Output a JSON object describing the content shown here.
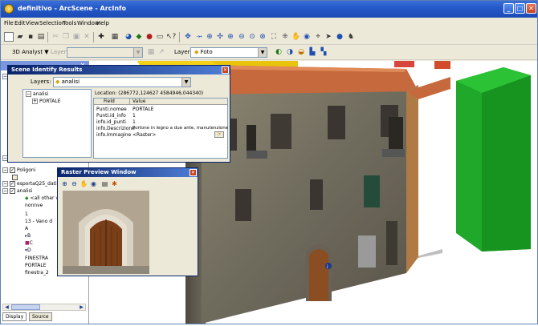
{
  "window": {
    "title": "definitivo - ArcScene - ArcInfo"
  },
  "menu": [
    "File",
    "Edit",
    "View",
    "Selection",
    "Tools",
    "Window",
    "Help"
  ],
  "toolbar2": {
    "analyst_label": "3D Analyst ▼",
    "layer_label": "Layer:",
    "layer_value": "Foto",
    "layer2_label": "Layer:"
  },
  "toc": {
    "rows": [
      {
        "check": "☑",
        "pm": "",
        "text": ""
      },
      {
        "check": "☑",
        "pm": "",
        "text": "Poligoni"
      },
      {
        "check": "☑",
        "pm": "",
        "text": "esportaQ25_dati"
      },
      {
        "check": "☑",
        "pm": "",
        "text": "analisi"
      },
      {
        "check": "",
        "pm": "",
        "text": "<all other values>"
      },
      {
        "check": "",
        "pm": "",
        "text": "nonnve"
      },
      {
        "check": "",
        "pm": "",
        "text": "1"
      },
      {
        "check": "",
        "pm": "",
        "text": "13 - Vano d"
      },
      {
        "check": "",
        "pm": "",
        "text": "A"
      },
      {
        "check": "",
        "pm": "",
        "text": "B"
      },
      {
        "check": "",
        "pm": "",
        "text": "C"
      },
      {
        "check": "",
        "pm": "",
        "text": "D"
      },
      {
        "check": "",
        "pm": "",
        "text": "FINESTRA"
      },
      {
        "check": "",
        "pm": "",
        "text": "PORTALE"
      },
      {
        "check": "",
        "pm": "",
        "text": "finestra_2"
      }
    ],
    "tabs": [
      "Display",
      "Source"
    ]
  },
  "identify": {
    "title": "Scene Identify Results",
    "layers_label": "Layers:",
    "layers_value": "analisi",
    "tree": [
      "analisi",
      "PORTALE"
    ],
    "location": "Location: (286772,124627 4584946,044340)",
    "columns": [
      "Field",
      "Value"
    ],
    "rows": [
      [
        "Punti.nomee",
        "PORTALE"
      ],
      [
        "Punti.id_info",
        "1"
      ],
      [
        "info.id_punti",
        "1"
      ],
      [
        "info.Descrizione",
        "Portone in legno a due ante, manutenzione"
      ],
      [
        "info.Immagine",
        "<Raster>"
      ]
    ]
  },
  "raster_preview": {
    "title": "Raster Preview Window"
  },
  "colors": {
    "titlebar": "#2457c8",
    "chrome": "#ece9d8",
    "green_block": "#1fa82a",
    "roof": "#c66a3d",
    "yellow_wall": "#f4d116"
  }
}
